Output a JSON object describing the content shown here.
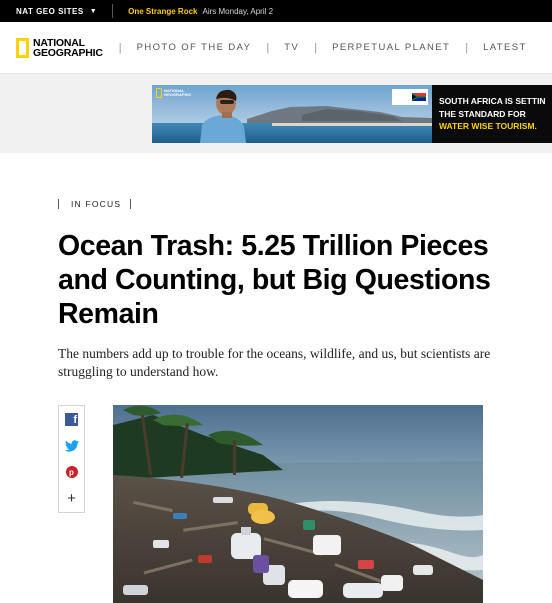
{
  "topbar": {
    "sites_label": "NAT GEO SITES",
    "promo_title": "One Strange Rock",
    "promo_airs": "Airs Monday, April 2"
  },
  "nav": {
    "logo_line1": "NATIONAL",
    "logo_line2": "GEOGRAPHIC",
    "links": [
      "PHOTO OF THE DAY",
      "TV",
      "PERPETUAL PLANET",
      "LATEST"
    ]
  },
  "ad": {
    "badge_line1": "NATIONAL",
    "badge_line2": "GEOGRAPHIC",
    "copy_line1": "SOUTH AFRICA IS SETTIN",
    "copy_line2": "THE STANDARD FOR",
    "copy_line3": "WATER WISE TOURISM."
  },
  "article": {
    "kicker": "IN FOCUS",
    "headline": "Ocean Trash: 5.25 Trillion Pieces and Counting, but Big Questions Remain",
    "dek": "The numbers add up to trouble for the oceans, wildlife, and us, but scientists are struggling to understand how."
  },
  "share": {
    "facebook_glyph": "f",
    "pinterest_glyph": "p",
    "more_glyph": "+"
  },
  "colors": {
    "brand_yellow": "#ffd200",
    "promo_yellow": "#ffce00",
    "facebook": "#3b5998",
    "twitter": "#1da1f2",
    "pinterest": "#cb2027"
  }
}
